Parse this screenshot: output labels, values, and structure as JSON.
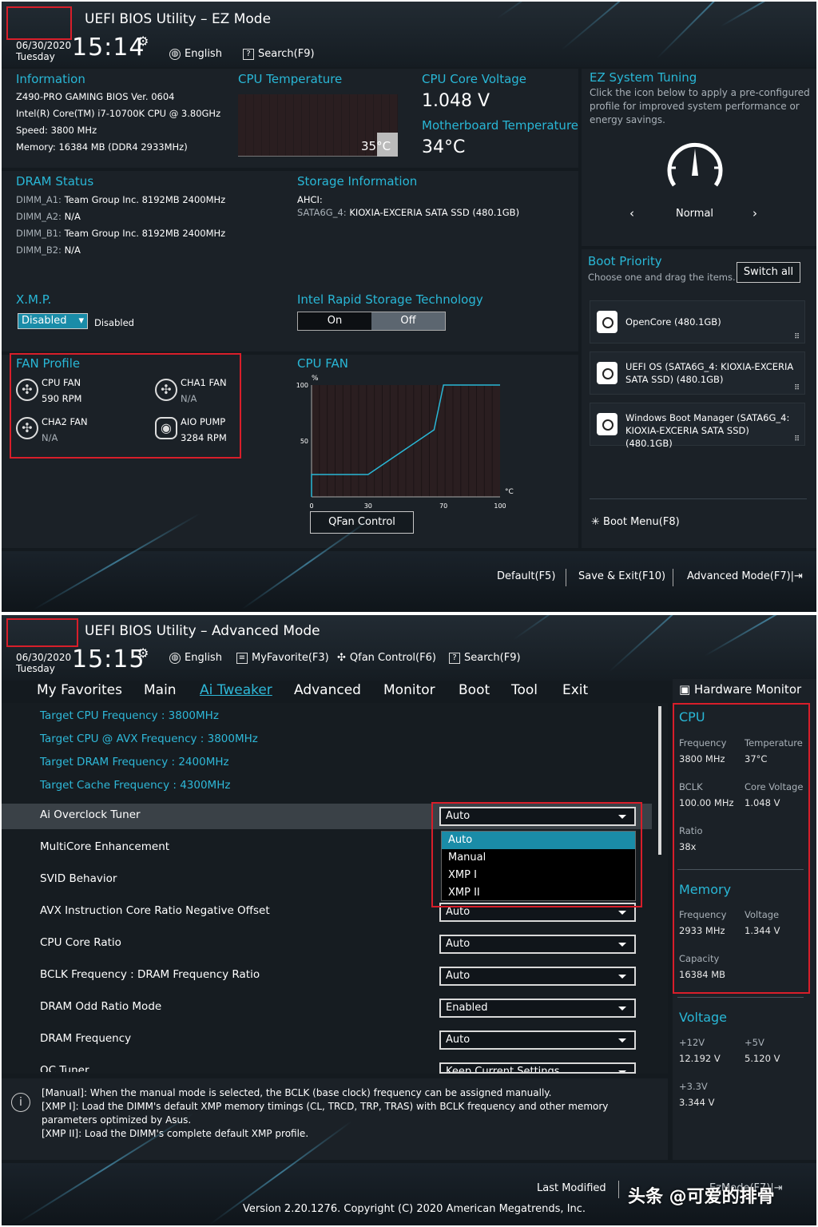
{
  "ez": {
    "title": "UEFI BIOS Utility – EZ Mode",
    "date": "06/30/2020",
    "day": "Tuesday",
    "time": "15:14",
    "language": "English",
    "search": "Search(F9)",
    "info": {
      "heading": "Information",
      "lines": [
        "Z490-PRO GAMING    BIOS Ver. 0604",
        "Intel(R) Core(TM) i7-10700K CPU @ 3.80GHz",
        "Speed: 3800 MHz",
        "Memory: 16384 MB (DDR4 2933MHz)"
      ]
    },
    "cpu_temp": {
      "heading": "CPU Temperature",
      "value": "35°C"
    },
    "cpu_voltage": {
      "heading": "CPU Core Voltage",
      "value": "1.048 V"
    },
    "mb_temp": {
      "heading": "Motherboard Temperature",
      "value": "34°C"
    },
    "ez_tuning": {
      "heading": "EZ System Tuning",
      "desc": "Click the icon below to apply a pre-configured profile for improved system performance or energy savings.",
      "mode": "Normal",
      "prev": "‹",
      "next": "›"
    },
    "dram": {
      "heading": "DRAM Status",
      "slots": [
        {
          "slot": "DIMM_A1:",
          "value": "Team Group Inc. 8192MB 2400MHz"
        },
        {
          "slot": "DIMM_A2:",
          "value": "N/A"
        },
        {
          "slot": "DIMM_B1:",
          "value": "Team Group Inc. 8192MB 2400MHz"
        },
        {
          "slot": "DIMM_B2:",
          "value": "N/A"
        }
      ]
    },
    "storage": {
      "heading": "Storage Information",
      "ahci": "AHCI:",
      "port": "SATA6G_4:",
      "device": "KIOXIA-EXCERIA SATA SSD (480.1GB)"
    },
    "xmp": {
      "heading": "X.M.P.",
      "select": "Disabled",
      "status": "Disabled"
    },
    "irst": {
      "heading": "Intel Rapid Storage Technology",
      "on": "On",
      "off": "Off"
    },
    "boot": {
      "heading": "Boot Priority",
      "hint": "Choose one and drag the items.",
      "switch_all": "Switch all",
      "items": [
        "OpenCore (480.1GB)",
        "UEFI OS (SATA6G_4: KIOXIA-EXCERIA SATA SSD) (480.1GB)",
        "Windows Boot Manager (SATA6G_4: KIOXIA-EXCERIA SATA SSD) (480.1GB)"
      ],
      "boot_menu": "Boot Menu(F8)"
    },
    "fan_profile": {
      "heading": "FAN Profile",
      "fans": [
        {
          "name": "CPU FAN",
          "value": "590 RPM"
        },
        {
          "name": "CHA1 FAN",
          "value": "N/A"
        },
        {
          "name": "CHA2 FAN",
          "value": "N/A"
        },
        {
          "name": "AIO PUMP",
          "value": "3284 RPM"
        }
      ]
    },
    "cpu_fan_chart": {
      "heading": "CPU FAN",
      "y_unit": "%",
      "x_unit": "°C",
      "y_ticks": [
        "100",
        "50"
      ],
      "x_ticks": [
        "0",
        "30",
        "70",
        "100"
      ],
      "qfan": "QFan Control"
    },
    "footer": {
      "default": "Default(F5)",
      "save": "Save & Exit(F10)",
      "advanced": "Advanced Mode(F7)|⇥"
    }
  },
  "chart_data": {
    "type": "line",
    "title": "CPU FAN",
    "xlabel": "°C",
    "ylabel": "%",
    "xlim": [
      0,
      100
    ],
    "ylim": [
      0,
      100
    ],
    "x": [
      0,
      0,
      30,
      65,
      70,
      100
    ],
    "values": [
      0,
      20,
      20,
      60,
      100,
      100
    ]
  },
  "adv": {
    "title": "UEFI BIOS Utility – Advanced Mode",
    "date": "06/30/2020",
    "day": "Tuesday",
    "time": "15:15",
    "language": "English",
    "favorite": "MyFavorite(F3)",
    "qfan": "Qfan Control(F6)",
    "search": "Search(F9)",
    "tabs": [
      "My Favorites",
      "Main",
      "Ai Tweaker",
      "Advanced",
      "Monitor",
      "Boot",
      "Tool",
      "Exit"
    ],
    "targets": [
      "Target CPU Frequency : 3800MHz",
      "Target CPU @ AVX Frequency : 3800MHz",
      "Target DRAM Frequency : 2400MHz",
      "Target Cache Frequency : 4300MHz"
    ],
    "settings": [
      {
        "label": "Ai Overclock Tuner",
        "value": "Auto"
      },
      {
        "label": "MultiCore Enhancement",
        "value": ""
      },
      {
        "label": "SVID Behavior",
        "value": ""
      },
      {
        "label": "AVX Instruction Core Ratio Negative Offset",
        "value": "Auto"
      },
      {
        "label": "CPU Core Ratio",
        "value": "Auto"
      },
      {
        "label": "BCLK Frequency : DRAM Frequency Ratio",
        "value": "Auto"
      },
      {
        "label": "DRAM Odd Ratio Mode",
        "value": "Enabled"
      },
      {
        "label": "DRAM Frequency",
        "value": "Auto"
      },
      {
        "label": "OC Tuner",
        "value": "Keep Current Settings"
      }
    ],
    "dropdown_options": [
      "Auto",
      "Manual",
      "XMP I",
      "XMP II"
    ],
    "help": [
      "[Manual]: When the manual mode is selected, the BCLK (base clock) frequency can be assigned manually.",
      "[XMP I]:  Load the DIMM's default XMP memory timings (CL, TRCD, TRP, TRAS) with BCLK frequency and other memory parameters optimized by Asus.",
      "[XMP II]:  Load the DIMM's complete default XMP profile."
    ],
    "hw": {
      "heading": "Hardware Monitor",
      "cpu": {
        "heading": "CPU",
        "frequency_label": "Frequency",
        "frequency": "3800 MHz",
        "temp_label": "Temperature",
        "temp": "37°C",
        "bclk_label": "BCLK",
        "bclk": "100.00 MHz",
        "volt_label": "Core Voltage",
        "volt": "1.048 V",
        "ratio_label": "Ratio",
        "ratio": "38x"
      },
      "memory": {
        "heading": "Memory",
        "frequency_label": "Frequency",
        "frequency": "2933 MHz",
        "volt_label": "Voltage",
        "volt": "1.344 V",
        "capacity_label": "Capacity",
        "capacity": "16384 MB"
      },
      "voltage": {
        "heading": "Voltage",
        "v12_label": "+12V",
        "v12": "12.192 V",
        "v5_label": "+5V",
        "v5": "5.120 V",
        "v33_label": "+3.3V",
        "v33": "3.344 V"
      }
    },
    "last_modified": "Last Modified",
    "ezmode": "EzMode(F7)|⇥",
    "version": "Version 2.20.1276. Copyright (C) 2020 American Megatrends, Inc.",
    "watermark": "头条 @可爱的排骨"
  }
}
